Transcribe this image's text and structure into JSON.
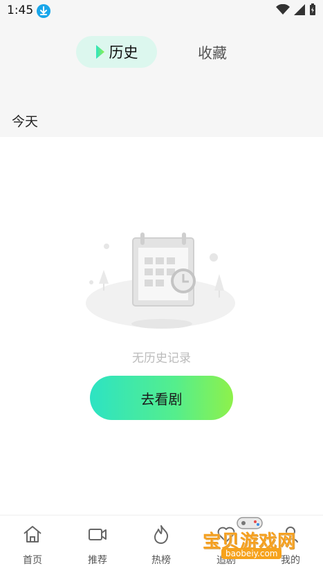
{
  "status_bar": {
    "time": "1:45"
  },
  "tabs": {
    "active_label": "历史",
    "inactive_label": "收藏"
  },
  "section": {
    "label": "今天"
  },
  "empty_state": {
    "message": "无历史记录",
    "button_label": "去看剧"
  },
  "nav": {
    "items": [
      {
        "label": "首页",
        "icon": "home-icon"
      },
      {
        "label": "推荐",
        "icon": "video-icon"
      },
      {
        "label": "热榜",
        "icon": "flame-icon"
      },
      {
        "label": "追剧",
        "icon": "heart-icon"
      },
      {
        "label": "我的",
        "icon": "user-icon"
      }
    ]
  },
  "watermark": {
    "title": "宝贝游戏网",
    "url": "baobeiy.com"
  },
  "colors": {
    "accent_gradient_start": "#2de3c3",
    "accent_gradient_end": "#8ef14b",
    "active_tab_bg": "#dcf7ee"
  }
}
